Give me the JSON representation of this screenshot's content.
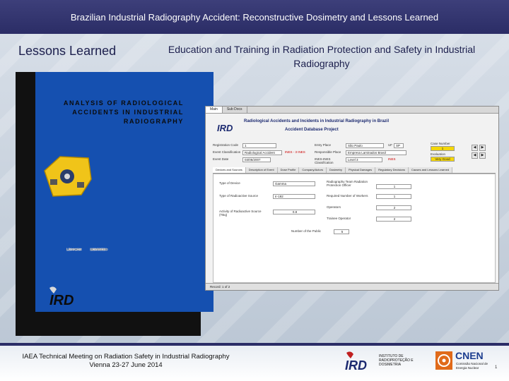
{
  "header": {
    "title": "Brazilian Industrial Radiography Accident: Reconstructive Dosimetry and Lessons Learned"
  },
  "slide": {
    "heading": "Lessons Learned",
    "subtitle": "Education and Training in Radiation Protection and Safety in Industrial Radiography"
  },
  "cover": {
    "title_lines": [
      "ANALYSIS OF RADIOLOGICAL",
      "ACCIDENTS IN INDUSTRIAL",
      "RADIOGRAPHY"
    ],
    "lessons_row1_left": "LESSONS",
    "lessons_row1_right": "IDENTIFIED",
    "lessons_row2_left": "LESSONS",
    "lessons_row2_right": "LEARNED",
    "logo_text": "IRD"
  },
  "app": {
    "tabs": [
      "Main",
      "Sub Docs"
    ],
    "banner_title": "Radiological Accidents and Incidents in Industrial Radiography in Brazil",
    "banner_subtitle": "Accident Database Project",
    "logo_text": "IRD",
    "fields": {
      "reg_label": "Registration Code",
      "reg_value": "1",
      "entry_label": "Entry Place",
      "entry_value": "São Paulo",
      "uf_label": "UF",
      "uf_value": "SP",
      "type_label": "Event Classification",
      "type_value": "Radiological Accident",
      "type_tag": "INES - 3  INES",
      "source_label": "Responsible Place",
      "source_value": "Empresa Laminados Brasil",
      "date_label": "Event Date",
      "date_value": "03/06/2007",
      "ines_label": "INES-INES Classification",
      "ines_value": "Level 3",
      "ines_code": "INES",
      "case_label": "Case Number",
      "case_value": "1",
      "eval_label": "Evaluation",
      "eval_value": "Very Good"
    },
    "subtabs": [
      "Devices and Sources",
      "Description of Event",
      "Dose Profile",
      "Company/Actors",
      "Dosimetry",
      "Physical Damages",
      "Regulatory Decisions",
      "Causes and Lessons Learned"
    ],
    "panel": {
      "equip_label": "Type of Device",
      "equip_value": "Gamma",
      "dist_label": "Radiography Team Radiation Protection Officer",
      "dist_value": "1",
      "source_type_label": "Type of Radioactive Source",
      "source_type_value": "Ir-192",
      "req_label": "Required Number of Workers",
      "req_value": "1",
      "activity_label": "Activity of Radioactive Source (TBq)",
      "activity_value": "0.8",
      "operators_label": "Operators",
      "operators_value": "2",
      "trainees_label": "Trainee Operator",
      "trainees_value": "2",
      "public_label": "Number of the Public",
      "public_value": "5"
    },
    "status": "Record: 1 of 2"
  },
  "footer": {
    "line1": "IAEA Technical Meeting on Radiation Safety in Industrial Radiography",
    "line2": "Vienna 23-27 June 2014",
    "ird_name": "INSTITUTO DE RADIOPROTEÇÃO E DOSIMETRIA",
    "ird_logo": "IRD",
    "cnen_name": "CNEN",
    "cnen_sub": "Comissão Nacional de Energia Nuclear",
    "page_number": "1"
  },
  "colors": {
    "header_bg": "#2b2d66",
    "cover_blue": "#1550b0",
    "highlight_yellow": "#f4d70a",
    "title_navy": "#1c1f4d"
  }
}
